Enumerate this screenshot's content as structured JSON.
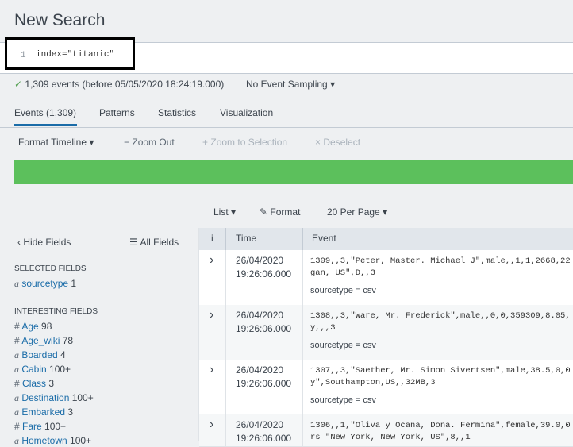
{
  "page_title": "New Search",
  "search": {
    "line_number": "1",
    "query": "index=\"titanic\""
  },
  "status": {
    "check": "✓",
    "events_text": "1,309 events (before 05/05/2020 18:24:19.000)",
    "sampling": "No Event Sampling"
  },
  "tabs": [
    {
      "label": "Events (1,309)"
    },
    {
      "label": "Patterns"
    },
    {
      "label": "Statistics"
    },
    {
      "label": "Visualization"
    }
  ],
  "timeline": {
    "format": "Format Timeline",
    "zoom_out": "Zoom Out",
    "zoom_selection": "Zoom to Selection",
    "deselect": "Deselect"
  },
  "controls": {
    "list": "List",
    "format": "Format",
    "per_page": "20 Per Page"
  },
  "fields_panel": {
    "hide_fields": "Hide Fields",
    "all_fields": "All Fields",
    "selected_heading": "SELECTED FIELDS",
    "selected": [
      {
        "type": "a",
        "name": "sourcetype",
        "count": "1"
      }
    ],
    "interesting_heading": "INTERESTING FIELDS",
    "interesting": [
      {
        "type": "#",
        "name": "Age",
        "count": "98"
      },
      {
        "type": "#",
        "name": "Age_wiki",
        "count": "78"
      },
      {
        "type": "a",
        "name": "Boarded",
        "count": "4"
      },
      {
        "type": "a",
        "name": "Cabin",
        "count": "100+"
      },
      {
        "type": "#",
        "name": "Class",
        "count": "3"
      },
      {
        "type": "a",
        "name": "Destination",
        "count": "100+"
      },
      {
        "type": "a",
        "name": "Embarked",
        "count": "3"
      },
      {
        "type": "#",
        "name": "Fare",
        "count": "100+"
      },
      {
        "type": "a",
        "name": "Hometown",
        "count": "100+"
      }
    ]
  },
  "table": {
    "headers": {
      "info": "i",
      "time": "Time",
      "event": "Event"
    },
    "rows": [
      {
        "date": "26/04/2020",
        "time": "19:26:06.000",
        "line1": "1309,,3,\"Peter, Master. Michael J\",male,,1,1,2668,22",
        "line2": "gan, US\",D,,3",
        "sourcetype": "sourcetype = csv"
      },
      {
        "date": "26/04/2020",
        "time": "19:26:06.000",
        "line1": "1308,,3,\"Ware, Mr. Frederick\",male,,0,0,359309,8.05,",
        "line2": "y,,,3",
        "sourcetype": "sourcetype = csv"
      },
      {
        "date": "26/04/2020",
        "time": "19:26:06.000",
        "line1": "1307,,3,\"Saether, Mr. Simon Sivertsen\",male,38.5,0,0",
        "line2": "y\",Southampton,US,,32MB,3",
        "sourcetype": "sourcetype = csv"
      },
      {
        "date": "26/04/2020",
        "time": "19:26:06.000",
        "line1": "1306,,1,\"Oliva y Ocana, Dona. Fermina\",female,39.0,0",
        "line2": "rs \"New York, New York, US\",8,,1",
        "sourcetype": ""
      }
    ]
  },
  "colors": {
    "accent": "#1a6ca8",
    "timeline": "#5cc05c",
    "check": "#53a051"
  }
}
